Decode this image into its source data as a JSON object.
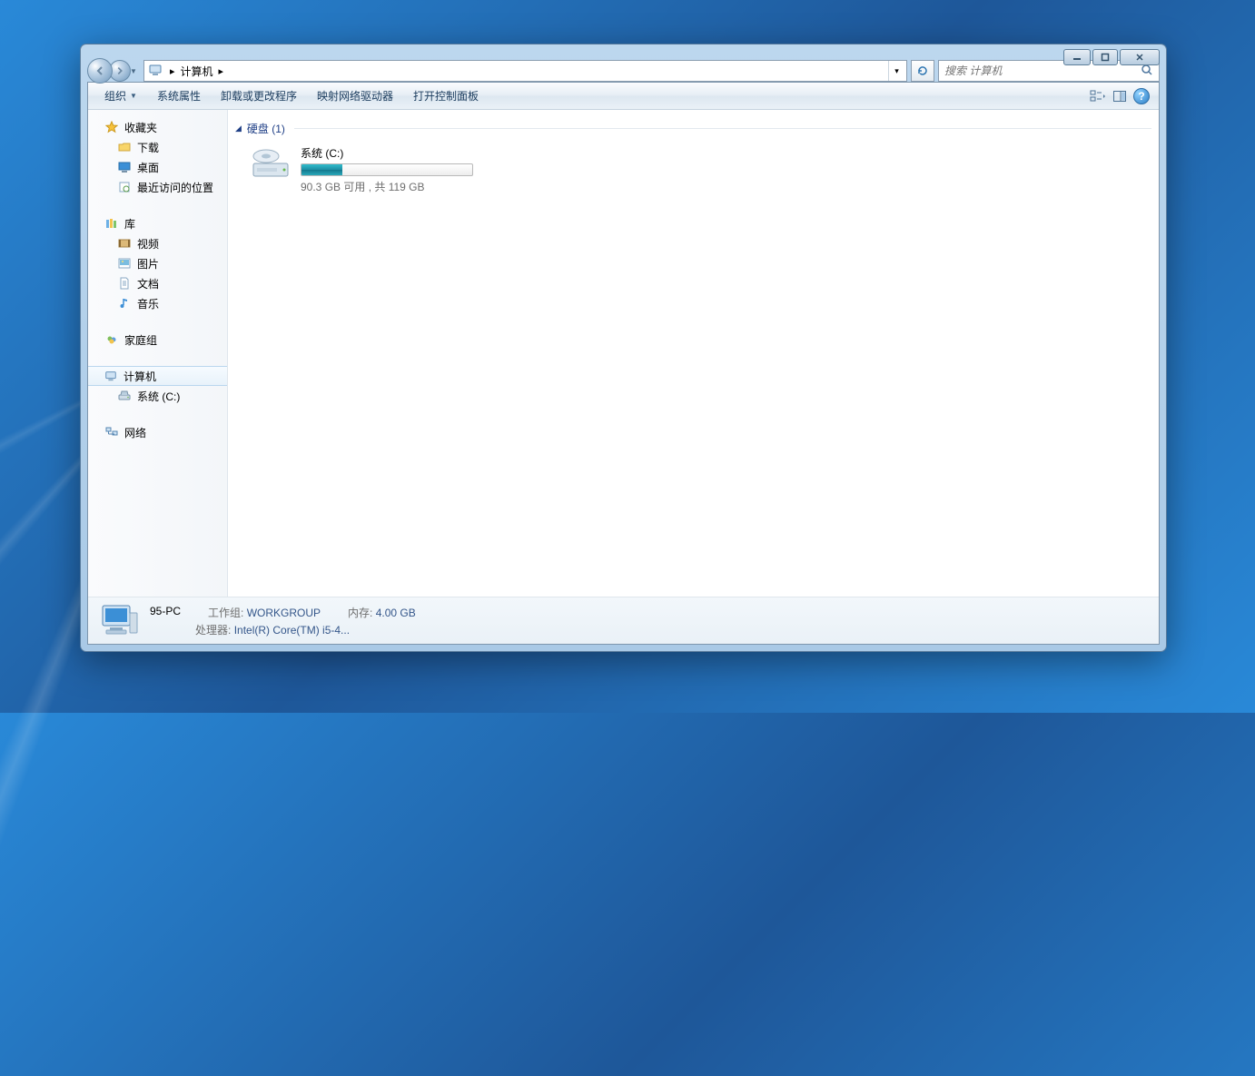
{
  "breadcrumb": {
    "root": "计算机"
  },
  "search": {
    "placeholder": "搜索 计算机"
  },
  "toolbar": {
    "organize": "组织",
    "properties": "系统属性",
    "uninstall": "卸载或更改程序",
    "map_drive": "映射网络驱动器",
    "control_panel": "打开控制面板"
  },
  "sidebar": {
    "favorites": "收藏夹",
    "downloads": "下载",
    "desktop": "桌面",
    "recent": "最近访问的位置",
    "libraries": "库",
    "videos": "视频",
    "pictures": "图片",
    "documents": "文档",
    "music": "音乐",
    "homegroup": "家庭组",
    "computer": "计算机",
    "sys_c": "系统 (C:)",
    "network": "网络"
  },
  "content": {
    "hdd_group": "硬盘 (1)",
    "drive_name": "系统 (C:)",
    "drive_free": "90.3 GB 可用 , 共 119 GB",
    "free_gb": 90.3,
    "total_gb": 119
  },
  "details": {
    "name": "95-PC",
    "workgroup_label": "工作组:",
    "workgroup": "WORKGROUP",
    "memory_label": "内存:",
    "memory": "4.00 GB",
    "cpu_label": "处理器:",
    "cpu": "Intel(R) Core(TM) i5-4..."
  }
}
